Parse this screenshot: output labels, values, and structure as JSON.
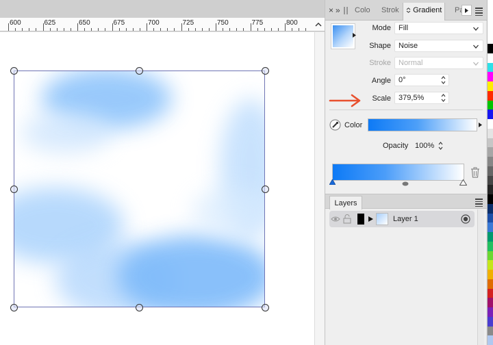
{
  "ruler": {
    "labels": [
      "600",
      "625",
      "650",
      "675",
      "700",
      "725",
      "750",
      "775",
      "800"
    ]
  },
  "panel": {
    "tabs": [
      "Colo",
      "Strok",
      "Gradient",
      "Pa"
    ],
    "controls": {
      "close_glyph": "×",
      "expand_glyph": "»"
    }
  },
  "gradient": {
    "mode_label": "Mode",
    "mode_value": "Fill",
    "shape_label": "Shape",
    "shape_value": "Noise",
    "stroke_label": "Stroke",
    "stroke_value": "Normal",
    "angle_label": "Angle",
    "angle_value": "0°",
    "scale_label": "Scale",
    "scale_value": "379,5%",
    "color_label": "Color",
    "opacity_label": "Opacity",
    "opacity_value": "100%",
    "swatch_colors": [
      "#0d7af6",
      "#ffffff"
    ]
  },
  "layers": {
    "tab_label": "Layers",
    "items": [
      {
        "name": "Layer 1"
      }
    ]
  },
  "annotation": {
    "arrow_color": "#e8502e"
  },
  "palette": {
    "colors": [
      "#000000",
      "#ffffff",
      "#2ee0e8",
      "#ff00ff",
      "#ffee00",
      "#ff2a00",
      "#00c400",
      "#1515f0",
      "#ffffff",
      "#e4e4e4",
      "#c6c6c6",
      "#a6a6a6",
      "#868686",
      "#666666",
      "#464646",
      "#262626",
      "#000000",
      "#0b2e6a",
      "#1c4fa8",
      "#3a79d6",
      "#009a6e",
      "#23c060",
      "#6cd832",
      "#c5e61a",
      "#f0b000",
      "#e06b00",
      "#d42020",
      "#a0106a",
      "#7a20b8",
      "#4a3cd0",
      "#8a8a8a",
      "#b0c8f0"
    ]
  }
}
